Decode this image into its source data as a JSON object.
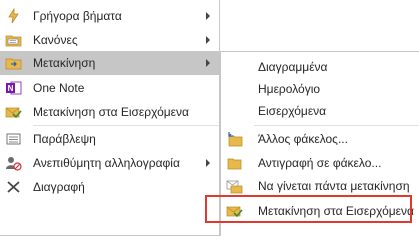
{
  "main_menu": {
    "items": [
      {
        "label": "Γρήγορα βήματα",
        "icon": "quick-steps-icon",
        "submenu": true
      },
      {
        "label": "Κανόνες",
        "icon": "rules-icon",
        "submenu": true
      },
      {
        "label": "Μετακίνηση",
        "icon": "move-folder-icon",
        "submenu": true,
        "selected": true
      },
      {
        "label": "One Note",
        "icon": "onenote-icon",
        "submenu": false
      },
      {
        "label": "Μετακίνηση στα Εισερχόμενα",
        "icon": "move-to-inbox-icon",
        "submenu": false
      },
      {
        "label": "Παράβλεψη",
        "icon": "ignore-icon",
        "submenu": false
      },
      {
        "label": "Ανεπιθύμητη αλληλογραφία",
        "icon": "junk-mail-icon",
        "submenu": true
      },
      {
        "label": "Διαγραφή",
        "icon": "delete-icon",
        "submenu": false
      }
    ]
  },
  "sub_menu": {
    "folders": [
      "Διαγραμμένα",
      "Ημερολόγιο",
      "Εισερχόμενα"
    ],
    "actions": [
      {
        "label": "Άλλος φάκελος...",
        "icon": "other-folder-icon"
      },
      {
        "label": "Αντιγραφή σε φάκελο...",
        "icon": "copy-to-folder-icon"
      },
      {
        "label": "Να γίνεται πάντα μετακίνηση",
        "icon": "always-move-icon"
      },
      {
        "label": "Μετακίνηση στα Εισερχόμενα",
        "icon": "move-to-inbox-icon"
      }
    ]
  },
  "colors": {
    "selected_bg": "#c6c6c6",
    "highlight_border": "#e0392f",
    "folder_yellow": "#e8b84a",
    "onenote_purple": "#7719aa",
    "check_green": "#3a8a3a"
  }
}
